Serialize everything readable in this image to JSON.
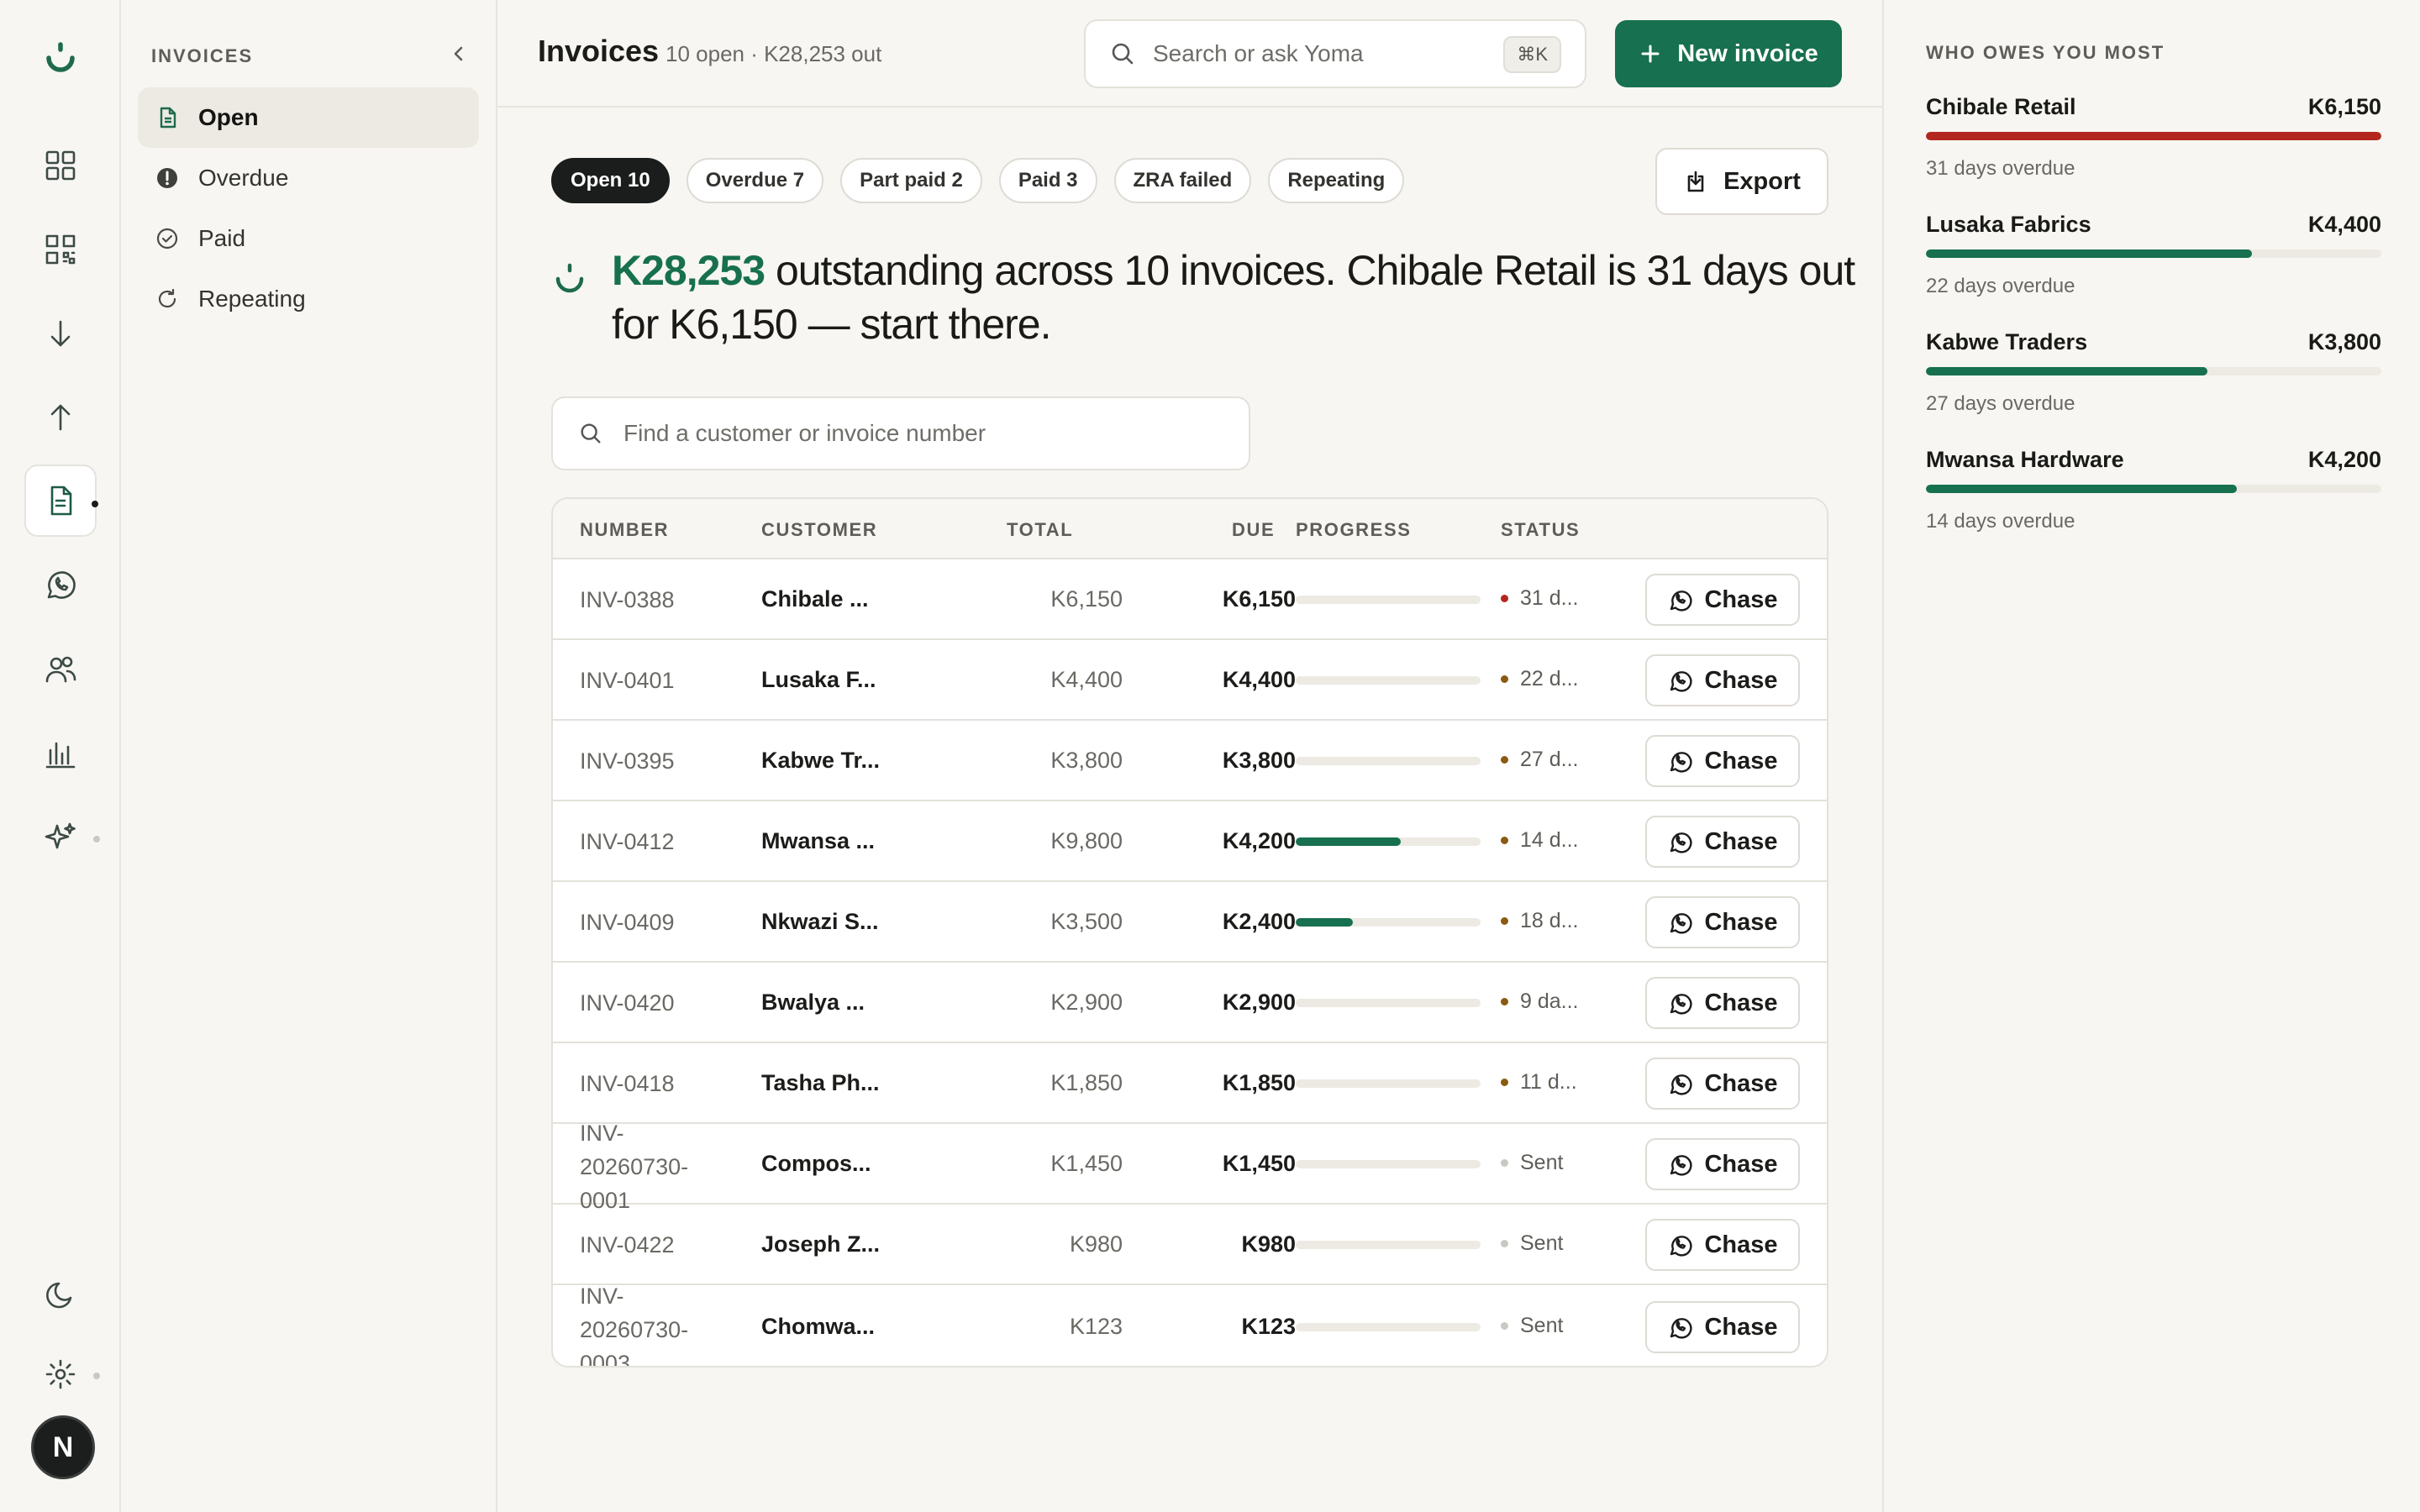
{
  "subnav": {
    "title": "INVOICES",
    "items": [
      {
        "label": "Open"
      },
      {
        "label": "Overdue"
      },
      {
        "label": "Paid"
      },
      {
        "label": "Repeating"
      }
    ]
  },
  "header": {
    "title": "Invoices",
    "subtitle": "10 open · K28,253 out",
    "search_placeholder": "Search or ask Yoma",
    "search_shortcut": "⌘K",
    "new_invoice": "New invoice"
  },
  "filters": [
    "Open 10",
    "Overdue 7",
    "Part paid 2",
    "Paid 3",
    "ZRA failed",
    "Repeating"
  ],
  "export_label": "Export",
  "insight": {
    "amount": "K28,253",
    "text": " outstanding across 10 invoices. Chibale Retail is 31 days out for K6,150 — start there."
  },
  "find_placeholder": "Find a customer or invoice number",
  "table": {
    "headers": {
      "number": "NUMBER",
      "customer": "CUSTOMER",
      "total": "TOTAL",
      "due": "DUE",
      "progress": "PROGRESS",
      "status": "STATUS"
    },
    "chase_label": "Chase",
    "rows": [
      {
        "number": "INV-0388",
        "customer": "Chibale ...",
        "total": "K6,150",
        "due": "K6,150",
        "progress": 0,
        "status": "31 d...",
        "status_color": "#b3261e"
      },
      {
        "number": "INV-0401",
        "customer": "Lusaka F...",
        "total": "K4,400",
        "due": "K4,400",
        "progress": 0,
        "status": "22 d...",
        "status_color": "#8a5a12"
      },
      {
        "number": "INV-0395",
        "customer": "Kabwe Tr...",
        "total": "K3,800",
        "due": "K3,800",
        "progress": 0,
        "status": "27 d...",
        "status_color": "#8a5a12"
      },
      {
        "number": "INV-0412",
        "customer": "Mwansa ...",
        "total": "K9,800",
        "due": "K4,200",
        "progress": 0.57,
        "status": "14 d...",
        "status_color": "#8a5a12"
      },
      {
        "number": "INV-0409",
        "customer": "Nkwazi S...",
        "total": "K3,500",
        "due": "K2,400",
        "progress": 0.31,
        "status": "18 d...",
        "status_color": "#8a5a12"
      },
      {
        "number": "INV-0420",
        "customer": "Bwalya ...",
        "total": "K2,900",
        "due": "K2,900",
        "progress": 0,
        "status": "9 da...",
        "status_color": "#8a5a12"
      },
      {
        "number": "INV-0418",
        "customer": "Tasha Ph...",
        "total": "K1,850",
        "due": "K1,850",
        "progress": 0,
        "status": "11 d...",
        "status_color": "#8a5a12"
      },
      {
        "number": "INV-20260730-0001",
        "number_lines": [
          "INV-",
          "20260730-",
          "0001"
        ],
        "customer": "Compos...",
        "total": "K1,450",
        "due": "K1,450",
        "progress": 0,
        "status": "Sent",
        "status_color": "#c9c8c3"
      },
      {
        "number": "INV-0422",
        "customer": "Joseph Z...",
        "total": "K980",
        "due": "K980",
        "progress": 0,
        "status": "Sent",
        "status_color": "#c9c8c3"
      },
      {
        "number": "INV-20260730-0003",
        "number_lines": [
          "INV-",
          "20260730-",
          "0003"
        ],
        "customer": "Chomwa...",
        "total": "K123",
        "due": "K123",
        "progress": 0,
        "status": "Sent",
        "status_color": "#c9c8c3"
      }
    ]
  },
  "owes": {
    "title": "WHO OWES YOU MOST",
    "items": [
      {
        "name": "Chibale Retail",
        "amount": "K6,150",
        "sub": "31 days overdue",
        "level": 1.0,
        "color": "#b3261e"
      },
      {
        "name": "Lusaka Fabrics",
        "amount": "K4,400",
        "sub": "22 days overdue",
        "level": 0.715,
        "color": "#17704f"
      },
      {
        "name": "Kabwe Traders",
        "amount": "K3,800",
        "sub": "27 days overdue",
        "level": 0.618,
        "color": "#17704f"
      },
      {
        "name": "Mwansa Hardware",
        "amount": "K4,200",
        "sub": "14 days overdue",
        "level": 0.683,
        "color": "#17704f"
      }
    ]
  },
  "colors": {
    "accent": "#17704f",
    "danger": "#b3261e",
    "warning": "#8a5a12"
  }
}
